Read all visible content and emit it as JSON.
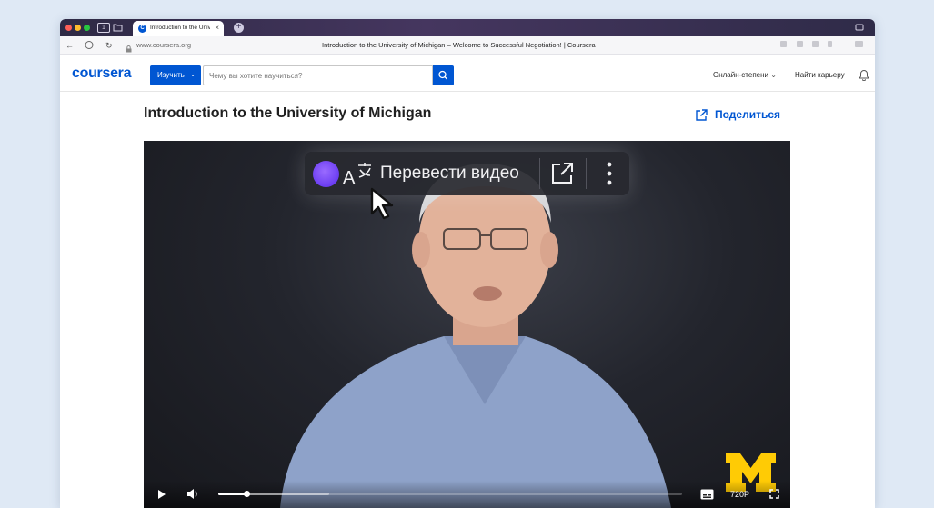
{
  "browser": {
    "tab_title": "Introduction to the University of Michigan",
    "tab_favicon": "C",
    "url": "www.coursera.org",
    "page_title": "Introduction to the University of Michigan – Welcome to Successful Negotiation! | Coursera"
  },
  "header": {
    "logo": "coursera",
    "explore_label": "Изучить",
    "search_placeholder": "Чему вы хотите научиться?",
    "links": [
      "Онлайн-степени",
      "Найти карьеру"
    ]
  },
  "course": {
    "title": "Introduction to the University of Michigan",
    "share_label": "Поделиться"
  },
  "video": {
    "translate_label": "Перевести видео",
    "quality": "720P",
    "progress": 0.06,
    "buffered": 0.24
  },
  "colors": {
    "brand": "#0056d2",
    "alice": "#6b3df2",
    "michigan_maize": "#ffcb05"
  },
  "icons": [
    "back-icon",
    "shield-icon",
    "reload-icon",
    "lock-icon",
    "search-icon",
    "bell-icon",
    "share-icon",
    "alice-icon",
    "translate-icon",
    "open-external-icon",
    "more-icon",
    "play-icon",
    "volume-icon",
    "subtitles-icon",
    "fullscreen-icon"
  ]
}
